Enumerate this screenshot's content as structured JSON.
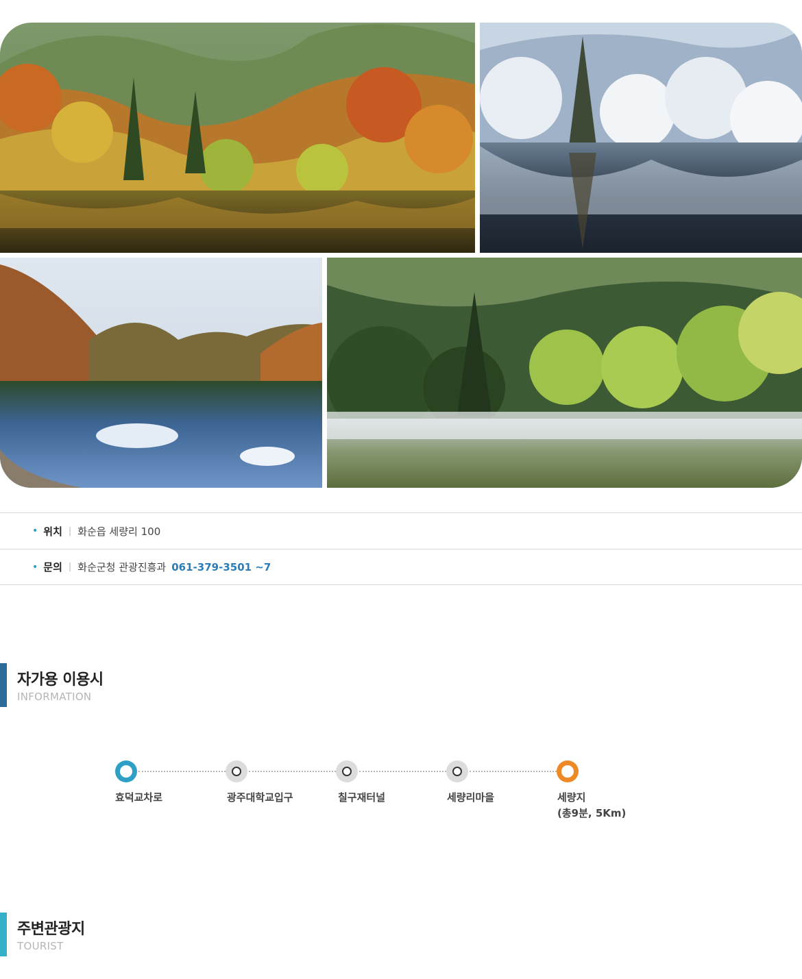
{
  "gallery": {
    "photos": [
      {
        "name": "autumn-reservoir",
        "season": "autumn"
      },
      {
        "name": "winter-reservoir",
        "season": "winter"
      },
      {
        "name": "cloud-reflection-reservoir",
        "season": "autumn"
      },
      {
        "name": "misty-spring-reservoir",
        "season": "spring"
      }
    ]
  },
  "info": {
    "location": {
      "label": "위치",
      "value": "화순읍 세량리 100"
    },
    "contact": {
      "label": "문의",
      "value": "화순군청 관광진흥과",
      "phone": "061-379-3501 ~7"
    }
  },
  "section_car": {
    "title": "자가용 이용시",
    "subtitle": "INFORMATION"
  },
  "route": {
    "stops": [
      {
        "label": "효덕교차로",
        "type": "start"
      },
      {
        "label": "광주대학교입구",
        "type": "mid"
      },
      {
        "label": "칠구재터널",
        "type": "mid"
      },
      {
        "label": "세량리마을",
        "type": "mid"
      },
      {
        "label": "세량지",
        "detail": "(총9분, 5Km)",
        "type": "end"
      }
    ]
  },
  "section_tourist": {
    "title": "주변관광지",
    "subtitle": "TOURIST"
  },
  "colors": {
    "accent_blue": "#2f9fc6",
    "accent_orange": "#ee8a26",
    "phone_blue": "#2a7db8",
    "bar_dark_blue": "#2c6a9a",
    "bar_teal": "#35b0c9"
  }
}
